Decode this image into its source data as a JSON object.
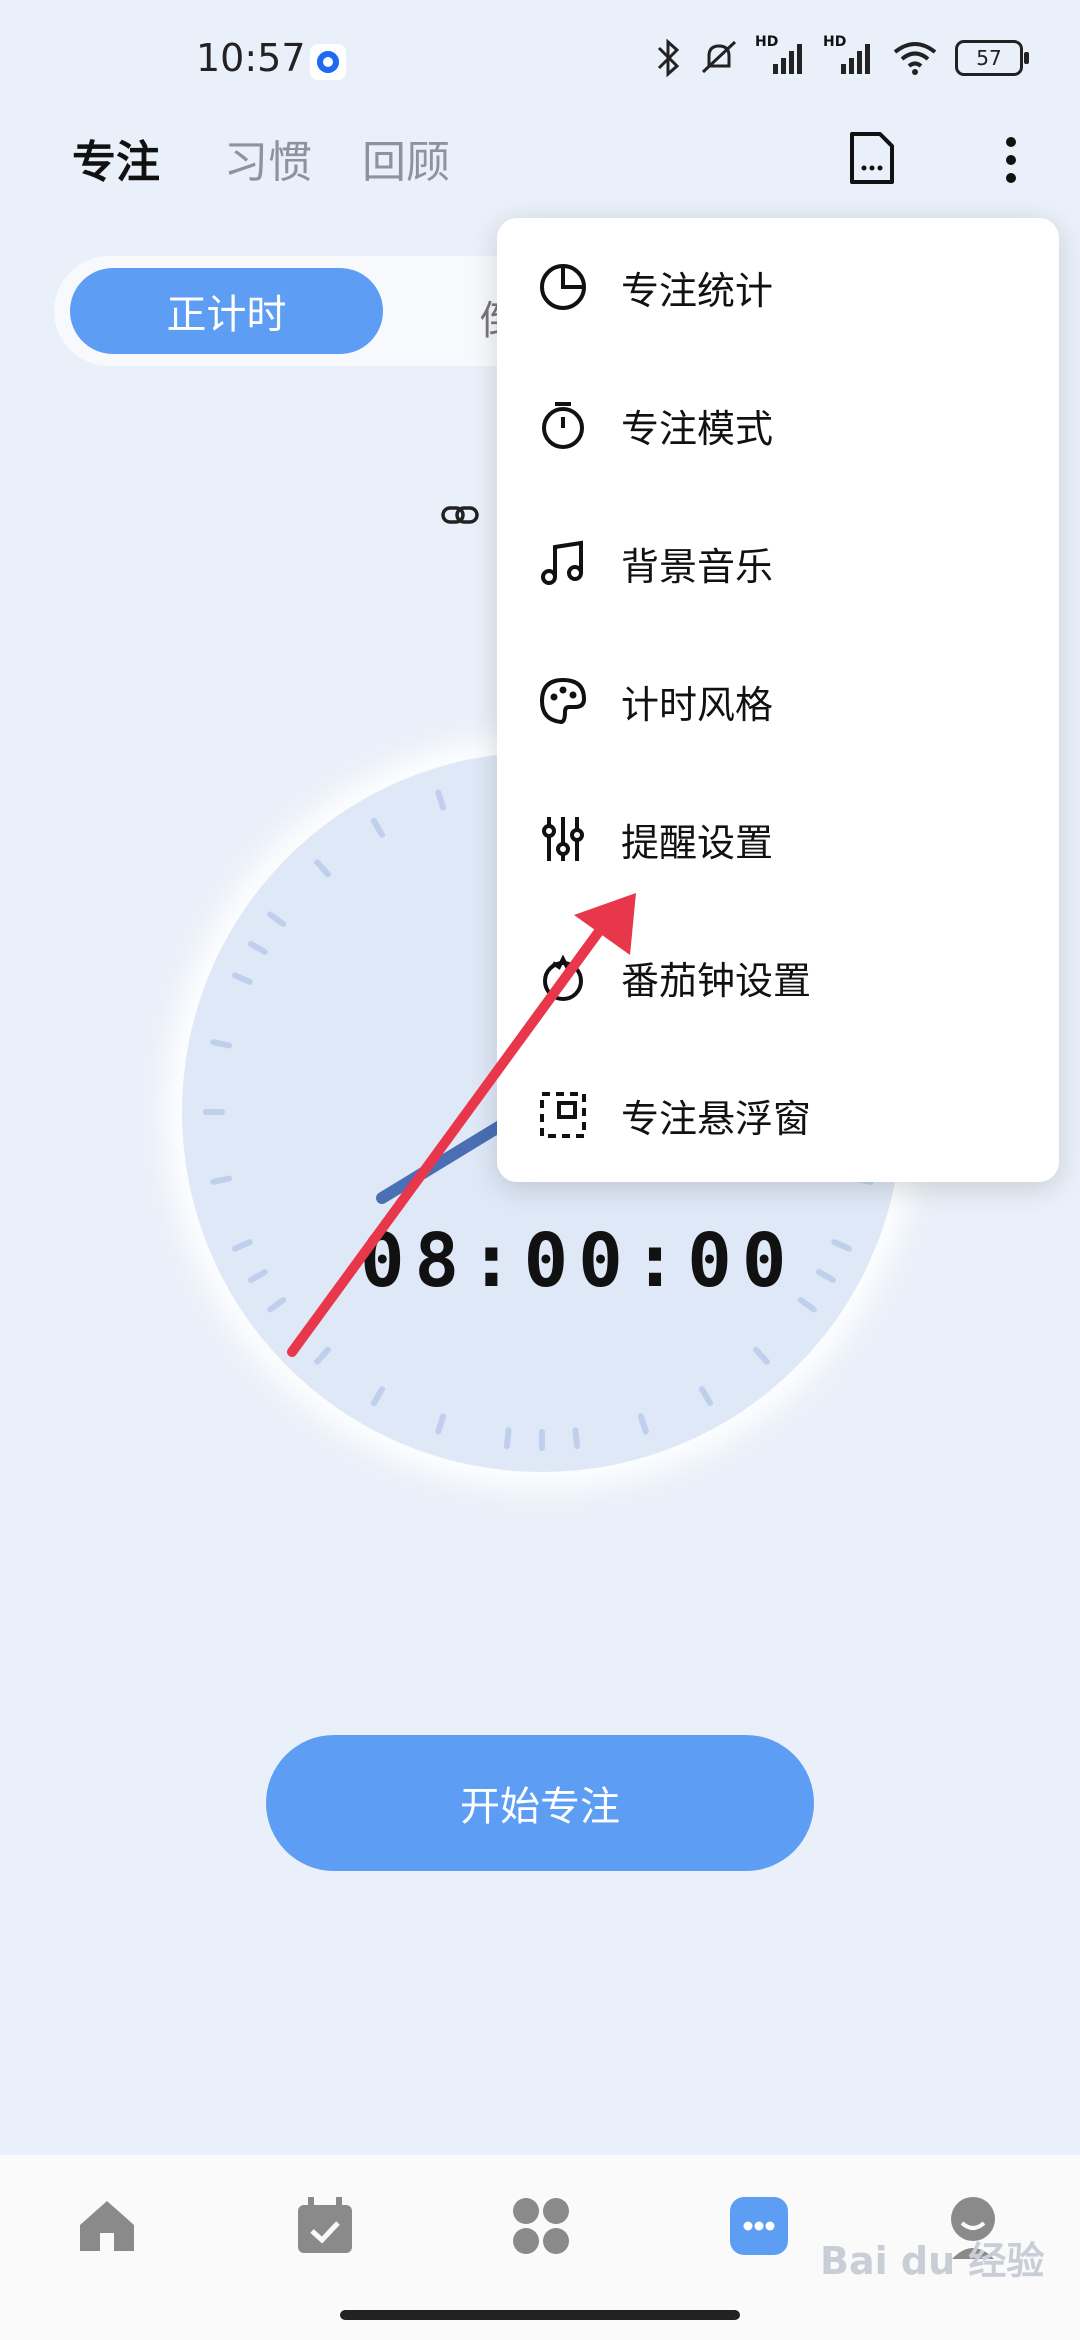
{
  "status_bar": {
    "time": "10:57",
    "battery": "57",
    "signal_label_1": "HD",
    "signal_label_2": "HD"
  },
  "header": {
    "tab_focus": "专注",
    "tab_habit": "习惯",
    "tab_review": "回顾"
  },
  "segment": {
    "active_label": "正计时",
    "other_label_partial": "倒"
  },
  "timer": {
    "display": "08:00:00"
  },
  "start_button": {
    "label": "开始专注"
  },
  "menu": {
    "items": [
      {
        "label": "专注统计",
        "icon": "pie-chart-icon"
      },
      {
        "label": "专注模式",
        "icon": "stopwatch-icon"
      },
      {
        "label": "背景音乐",
        "icon": "music-note-icon"
      },
      {
        "label": "计时风格",
        "icon": "palette-icon"
      },
      {
        "label": "提醒设置",
        "icon": "sliders-icon"
      },
      {
        "label": "番茄钟设置",
        "icon": "tomato-icon"
      },
      {
        "label": "专注悬浮窗",
        "icon": "floating-window-icon"
      }
    ]
  },
  "bottom_nav": {
    "items": [
      {
        "icon": "home-icon"
      },
      {
        "icon": "calendar-check-icon"
      },
      {
        "icon": "apps-grid-icon"
      },
      {
        "icon": "focus-icon",
        "active": true
      },
      {
        "icon": "profile-icon"
      }
    ]
  },
  "watermark": {
    "text": "Bai du 经验"
  },
  "colors": {
    "accent": "#5d9ef4",
    "arrow": "#e8364b",
    "background": "#eaf0f9"
  }
}
